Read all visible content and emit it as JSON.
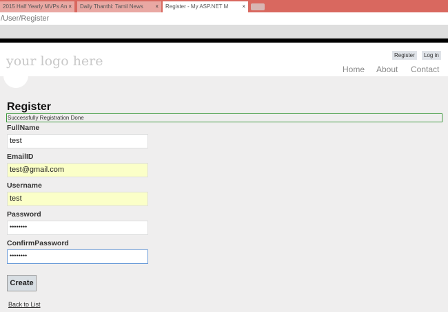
{
  "browser": {
    "tabs": [
      {
        "title": "2015 Half Yearly MVPs An"
      },
      {
        "title": "Daily Thanthi: Tamil News"
      },
      {
        "title": "Register - My ASP.NET M"
      }
    ],
    "close_glyph": "×",
    "address": "/User/Register"
  },
  "header": {
    "logo": "your logo here",
    "register": "Register",
    "login": "Log in",
    "nav": [
      "Home",
      "About",
      "Contact"
    ]
  },
  "page": {
    "title": "Register",
    "message": "Successfully Registration Done",
    "fields": [
      {
        "label": "FullName",
        "value": "test"
      },
      {
        "label": "EmailID",
        "value": "test@gmail.com"
      },
      {
        "label": "Username",
        "value": "test"
      },
      {
        "label": "Password",
        "value": "••••••••"
      },
      {
        "label": "ConfirmPassword",
        "value": "••••••••"
      }
    ],
    "create": "Create",
    "back": "Back to List"
  }
}
